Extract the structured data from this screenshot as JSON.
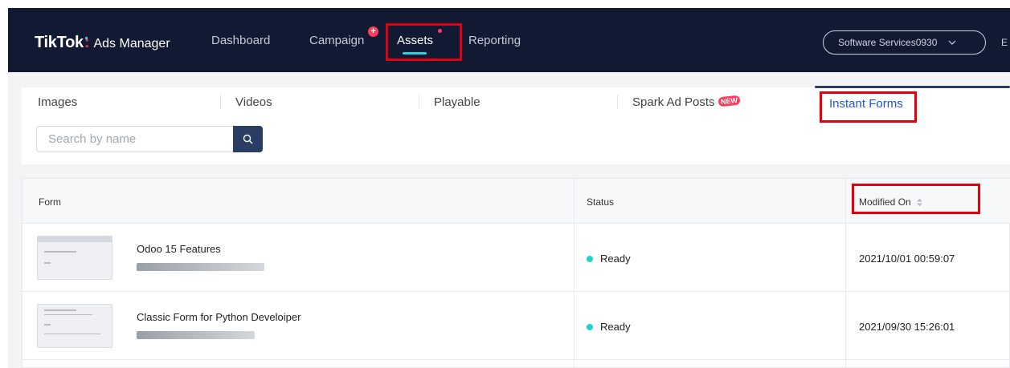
{
  "header": {
    "logo_brand": "TikTok",
    "logo_sub": "Ads Manager",
    "nav": [
      {
        "label": "Dashboard"
      },
      {
        "label": "Campaign"
      },
      {
        "label": "Assets"
      },
      {
        "label": "Reporting"
      }
    ],
    "campaign_badge": "+",
    "account": "Software Services0930",
    "edge_letter": "E"
  },
  "tabs": [
    {
      "label": "Images"
    },
    {
      "label": "Videos"
    },
    {
      "label": "Playable"
    },
    {
      "label": "Spark Ad Posts"
    },
    {
      "label": "Instant Forms"
    }
  ],
  "new_badge": "NEW",
  "search": {
    "placeholder": "Search by name"
  },
  "table": {
    "columns": [
      "Form",
      "Status",
      "Modified On"
    ],
    "rows": [
      {
        "name": "Odoo 15 Features",
        "status": "Ready",
        "modified": "2021/10/01 00:59:07"
      },
      {
        "name": "Classic Form for Python Develoiper",
        "status": "Ready",
        "modified": "2021/09/30 15:26:01"
      }
    ]
  },
  "colors": {
    "nav_bg": "#121a33",
    "accent": "#25d6e0",
    "highlight": "#e3000f",
    "status_ready": "#1fd5c9",
    "search_btn": "#2b3d63"
  }
}
